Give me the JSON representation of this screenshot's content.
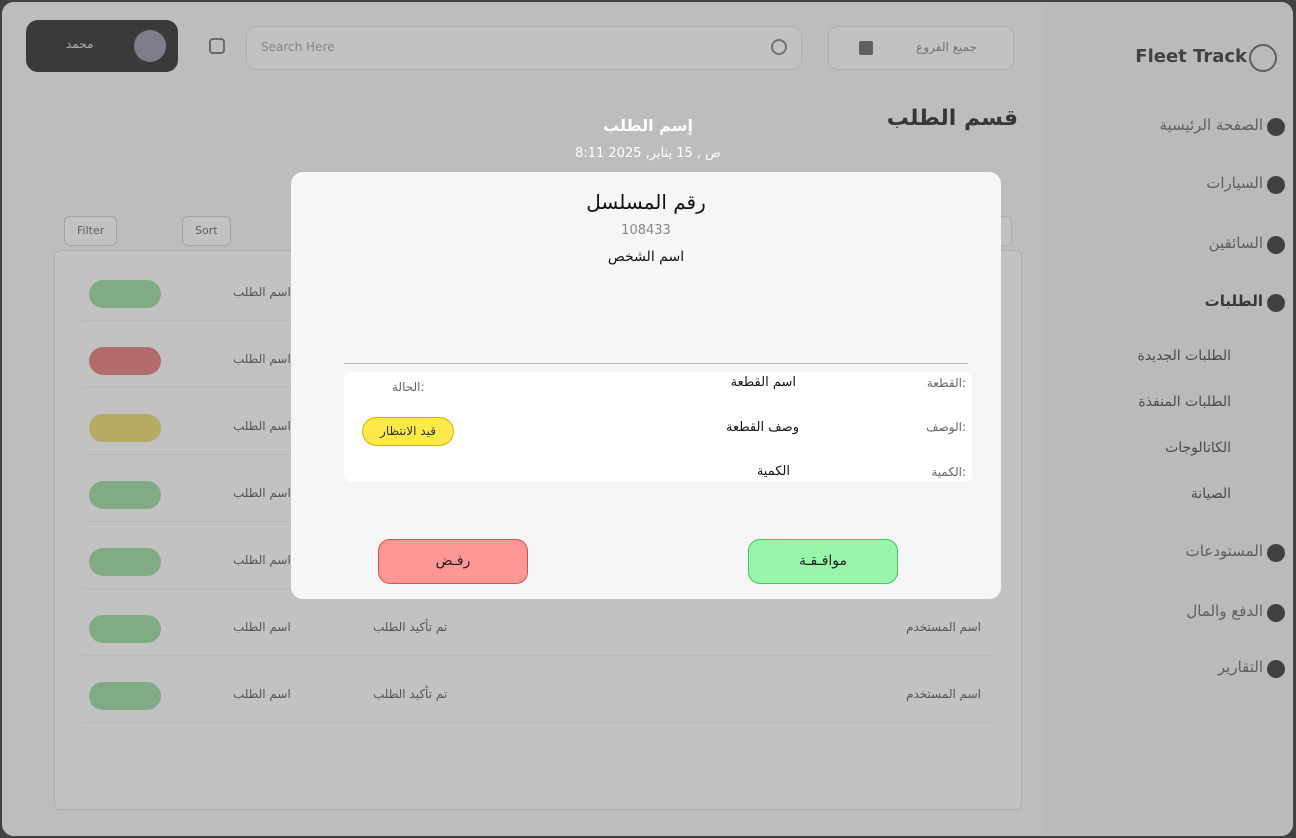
{
  "app": {
    "user_name": "محمد",
    "search_placeholder": "Search Here",
    "dropdown_label": "جميع الفروع",
    "page_title": "قسم الطلب",
    "filters": [
      "Filter",
      "Sort"
    ],
    "table_rows": [
      {
        "status_color": "#8ed897",
        "c1": "اسم الطلب",
        "c2": "",
        "c3": ""
      },
      {
        "status_color": "#e36b6b",
        "c1": "اسم الطلب",
        "c2": "",
        "c3": ""
      },
      {
        "status_color": "#e8d85a",
        "c1": "اسم الطلب",
        "c2": "",
        "c3": ""
      },
      {
        "status_color": "#8ed897",
        "c1": "اسم الطلب",
        "c2": "",
        "c3": ""
      },
      {
        "status_color": "#8ed897",
        "c1": "اسم الطلب",
        "c2": "",
        "c3": ""
      },
      {
        "status_color": "#8ed897",
        "c1": "اسم الطلب",
        "c2": "تم تأكيد الطلب",
        "c3": "اسم المستخدم"
      },
      {
        "status_color": "#8ed897",
        "c1": "اسم الطلب",
        "c2": "تم تأكيد الطلب",
        "c3": "اسم المستخدم"
      }
    ]
  },
  "sidebar": {
    "brand": "Fleet Track",
    "items": [
      {
        "label": "الصفحة الرئيسية"
      },
      {
        "label": "السيارات"
      },
      {
        "label": "السائقين"
      },
      {
        "label": "الطلبات"
      },
      {
        "label": "المستودعات"
      },
      {
        "label": "الدفع والمال"
      },
      {
        "label": "التقارير"
      }
    ],
    "sub_items": [
      "الطلبات الجديدة",
      "الطلبات المنفذة",
      "الكاتالوجات",
      "الصيانة"
    ]
  },
  "modal": {
    "request_title": "إسم الطلب",
    "request_date": "8:11  ص , 15 يناير, 2025",
    "serial_label": "رقم المسلسل",
    "serial_number": "108433",
    "person_name": "اسم  الشخص",
    "fields": {
      "part_label": "القطعة:",
      "part_value": "اسم القطعة",
      "desc_label": "الوصف:",
      "desc_value": "وصف القطعة",
      "qty_label": "الكمية:",
      "qty_value": "الكمية",
      "status_label": "الحالة:",
      "status_value": "قيد  الانتظار"
    },
    "approve_label": "موافـقـة",
    "reject_label": "رفـض",
    "colors": {
      "approve": "#97f5ac",
      "reject": "#ff9797",
      "pending": "#ffe94a"
    }
  }
}
